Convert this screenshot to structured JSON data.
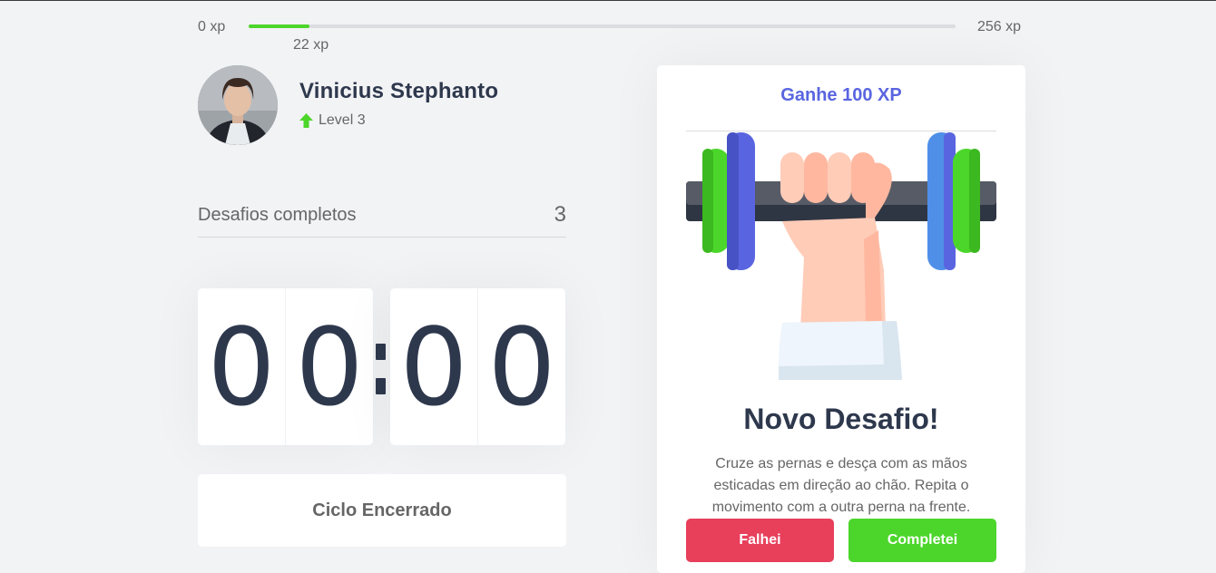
{
  "xp": {
    "min_label": "0 xp",
    "max_label": "256 xp",
    "current_label": "22 xp",
    "progress_fraction": 0.0859
  },
  "profile": {
    "name": "Vinicius Stephanto",
    "level_label": "Level 3",
    "level_icon": "arrow-up-icon"
  },
  "challenges": {
    "label": "Desafios completos",
    "count": "3"
  },
  "countdown": {
    "minute_left": "0",
    "minute_right": "0",
    "second_left": "0",
    "second_right": "0",
    "cycle_button_label": "Ciclo Encerrado"
  },
  "challenge_card": {
    "header": "Ganhe 100 XP",
    "illustration": "dumbbell-hand-icon",
    "title": "Novo Desafio!",
    "description": "Cruze as pernas e desça com as mãos esticadas em direção ao chão. Repita o movimento com a outra perna na frente.",
    "fail_label": "Falhei",
    "success_label": "Completei"
  },
  "colors": {
    "accent": "#5965e0",
    "success": "#4cd62b",
    "danger": "#e83f5b",
    "text": "#2e384d",
    "muted": "#666666",
    "background": "#f2f3f5"
  }
}
